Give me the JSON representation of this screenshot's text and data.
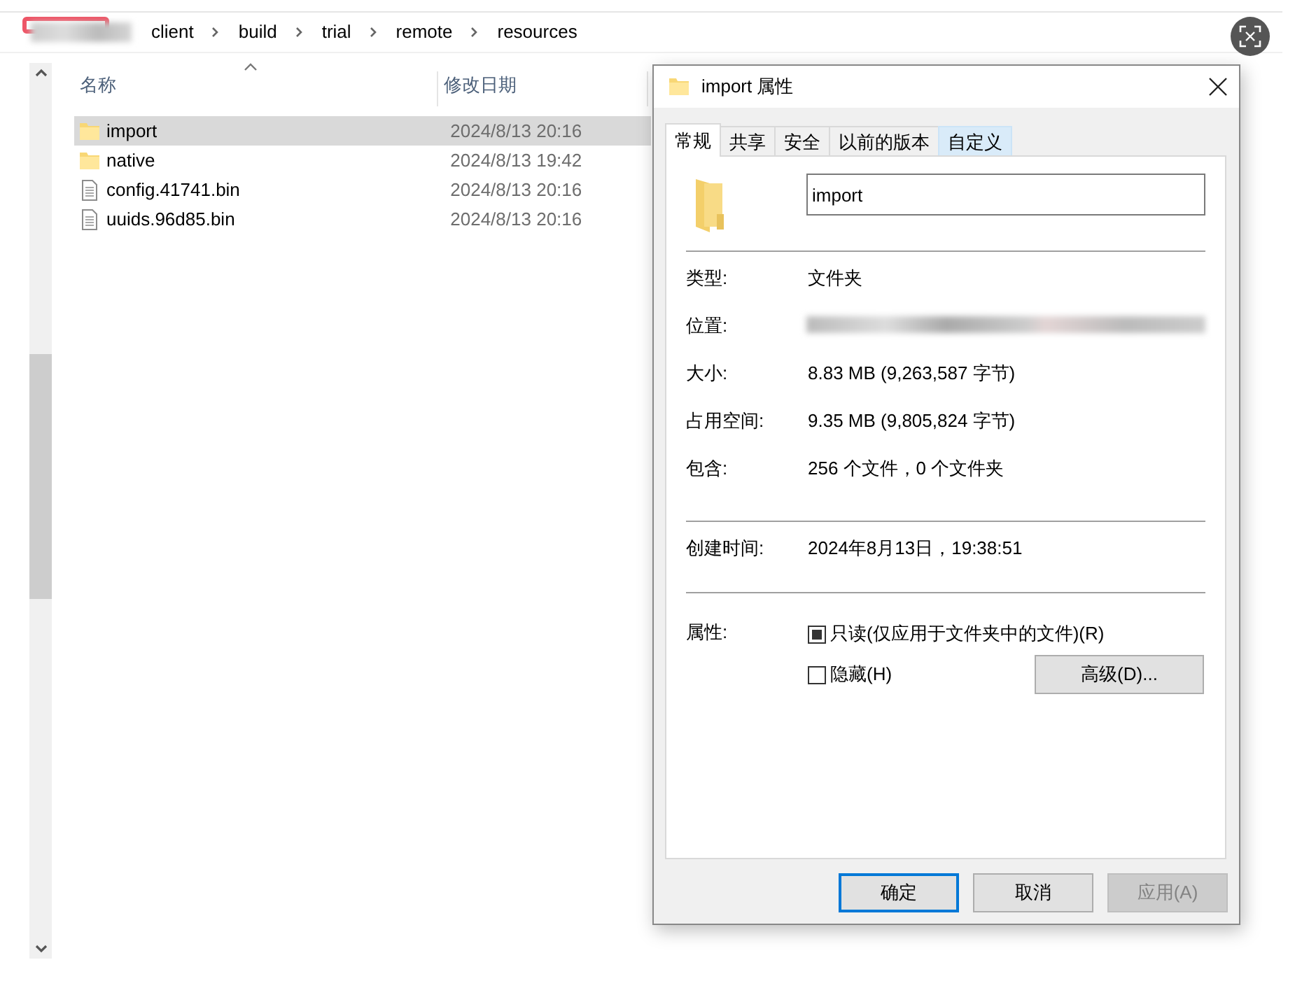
{
  "breadcrumb": [
    "client",
    "build",
    "trial",
    "remote",
    "resources"
  ],
  "file_list": {
    "columns": [
      "名称",
      "修改日期"
    ],
    "rows": [
      {
        "name": "import",
        "modified": "2024/8/13 20:16",
        "kind": "folder",
        "selected": true
      },
      {
        "name": "native",
        "modified": "2024/8/13 19:42",
        "kind": "folder",
        "selected": false
      },
      {
        "name": "config.41741.bin",
        "modified": "2024/8/13 20:16",
        "kind": "file",
        "selected": false
      },
      {
        "name": "uuids.96d85.bin",
        "modified": "2024/8/13 20:16",
        "kind": "file",
        "selected": false
      }
    ]
  },
  "dialog": {
    "title": "import 属性",
    "tabs": [
      {
        "label": "常规",
        "selected": true,
        "hovered": false
      },
      {
        "label": "共享",
        "selected": false,
        "hovered": false
      },
      {
        "label": "安全",
        "selected": false,
        "hovered": false
      },
      {
        "label": "以前的版本",
        "selected": false,
        "hovered": false
      },
      {
        "label": "自定义",
        "selected": false,
        "hovered": true
      }
    ],
    "name_value": "import",
    "groups": [
      [
        {
          "label": "类型:",
          "value": "文件夹"
        },
        {
          "label": "位置:",
          "kind": "redacted"
        },
        {
          "label": "大小:",
          "value": "8.83 MB (9,263,587 字节)"
        },
        {
          "label": "占用空间:",
          "value": "9.35 MB (9,805,824 字节)"
        },
        {
          "label": "包含:",
          "value": "256 个文件，0 个文件夹"
        }
      ],
      [
        {
          "label": "创建时间:",
          "value": "2024年8月13日，19:38:51"
        }
      ]
    ],
    "attributes_label": "属性:",
    "checkboxes": [
      {
        "label": "只读(仅应用于文件夹中的文件)(R)",
        "checked": false,
        "indeterminate": true
      },
      {
        "label": "隐藏(H)",
        "checked": false,
        "indeterminate": false
      }
    ],
    "advanced_button": "高级(D)...",
    "buttons": [
      {
        "label": "确定",
        "kind": "default",
        "disabled": false
      },
      {
        "label": "取消",
        "kind": "normal",
        "disabled": false
      },
      {
        "label": "应用(A)",
        "kind": "normal",
        "disabled": true
      }
    ]
  }
}
